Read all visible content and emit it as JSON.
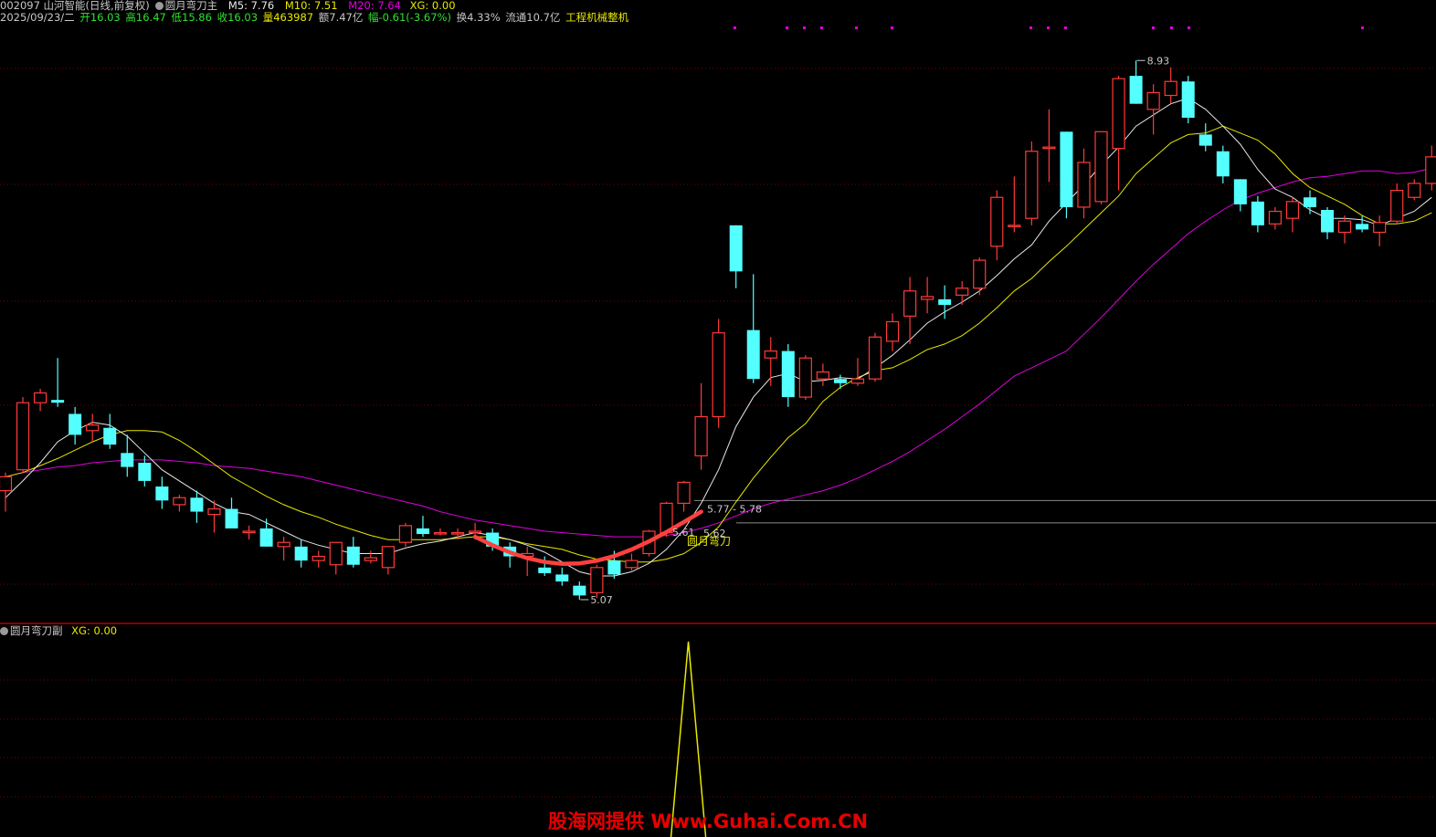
{
  "header": {
    "code_name": "002097 山河智能(日线,前复权)",
    "main_indicator": "圆月弯刀主",
    "m5": "M5: 7.76",
    "m10": "M10: 7.51",
    "m20": "M20: 7.64",
    "xg": "XG: 0.00",
    "date": "2025/09/23/二",
    "open": "开16.03",
    "high": "高16.47",
    "low": "低15.86",
    "close": "收16.03",
    "volume": "量463987",
    "amount": "额7.47亿",
    "change": "幅-0.61(-3.67%)",
    "turnover": "换4.33%",
    "float": "流通10.7亿",
    "industry": "工程机械整机"
  },
  "sub_header": {
    "name": "圆月弯刀副",
    "xg": "XG: 0.00"
  },
  "annotations": {
    "high_label": "8.93",
    "low_label": "5.07",
    "range_label": "5.77 - 5.78",
    "p1": "5.61",
    "p2": "5.62",
    "signal": "圆月弯刀"
  },
  "watermark": "股海网提供 Www.Guhai.Com.CN",
  "colors": {
    "up": "#ff3a3a",
    "down": "#54ffff",
    "m5": "#e8e8e8",
    "m10": "#e8e800",
    "m20": "#e000e0",
    "grid": "#7a0000",
    "separator": "#b00000",
    "arc": "#ff4040"
  },
  "chart_data": [
    {
      "type": "candlestick",
      "title": "圆月弯刀主",
      "ohlc": [
        [
          5.85,
          5.98,
          5.7,
          5.95
        ],
        [
          6.0,
          6.52,
          5.98,
          6.48
        ],
        [
          6.48,
          6.58,
          6.42,
          6.55
        ],
        [
          6.5,
          6.8,
          6.45,
          6.48
        ],
        [
          6.4,
          6.45,
          6.18,
          6.25
        ],
        [
          6.28,
          6.4,
          6.2,
          6.32
        ],
        [
          6.3,
          6.4,
          6.15,
          6.18
        ],
        [
          6.12,
          6.25,
          5.95,
          6.02
        ],
        [
          6.05,
          6.1,
          5.88,
          5.92
        ],
        [
          5.88,
          5.95,
          5.72,
          5.78
        ],
        [
          5.75,
          5.82,
          5.7,
          5.8
        ],
        [
          5.8,
          5.85,
          5.62,
          5.7
        ],
        [
          5.68,
          5.78,
          5.55,
          5.72
        ],
        [
          5.72,
          5.8,
          5.58,
          5.58
        ],
        [
          5.55,
          5.6,
          5.5,
          5.56
        ],
        [
          5.58,
          5.65,
          5.45,
          5.45
        ],
        [
          5.45,
          5.52,
          5.35,
          5.48
        ],
        [
          5.45,
          5.5,
          5.3,
          5.35
        ],
        [
          5.35,
          5.42,
          5.3,
          5.38
        ],
        [
          5.32,
          5.45,
          5.25,
          5.48
        ],
        [
          5.45,
          5.52,
          5.3,
          5.32
        ],
        [
          5.35,
          5.42,
          5.33,
          5.37
        ],
        [
          5.3,
          5.45,
          5.25,
          5.45
        ],
        [
          5.48,
          5.62,
          5.45,
          5.6
        ],
        [
          5.58,
          5.67,
          5.52,
          5.54
        ],
        [
          5.55,
          5.58,
          5.53,
          5.55
        ],
        [
          5.54,
          5.58,
          5.5,
          5.55
        ],
        [
          5.55,
          5.62,
          5.5,
          5.56
        ],
        [
          5.55,
          5.58,
          5.42,
          5.45
        ],
        [
          5.45,
          5.48,
          5.3,
          5.38
        ],
        [
          5.38,
          5.45,
          5.24,
          5.4
        ],
        [
          5.3,
          5.38,
          5.24,
          5.26
        ],
        [
          5.25,
          5.3,
          5.17,
          5.2
        ],
        [
          5.17,
          5.2,
          5.07,
          5.1
        ],
        [
          5.12,
          5.32,
          5.08,
          5.3
        ],
        [
          5.35,
          5.42,
          5.22,
          5.25
        ],
        [
          5.3,
          5.4,
          5.28,
          5.35
        ],
        [
          5.4,
          5.57,
          5.38,
          5.56
        ],
        [
          5.55,
          5.77,
          5.52,
          5.76
        ],
        [
          5.76,
          5.92,
          5.7,
          5.91
        ],
        [
          6.1,
          6.62,
          6.0,
          6.38
        ],
        [
          6.38,
          7.08,
          6.3,
          6.98
        ],
        [
          7.75,
          7.75,
          7.3,
          7.42
        ],
        [
          7.0,
          7.4,
          6.62,
          6.65
        ],
        [
          6.8,
          6.95,
          6.6,
          6.85
        ],
        [
          6.85,
          6.9,
          6.45,
          6.52
        ],
        [
          6.52,
          6.82,
          6.5,
          6.8
        ],
        [
          6.65,
          6.76,
          6.6,
          6.7
        ],
        [
          6.65,
          6.68,
          6.58,
          6.62
        ],
        [
          6.62,
          6.8,
          6.6,
          6.65
        ],
        [
          6.65,
          6.98,
          6.63,
          6.95
        ],
        [
          6.92,
          7.12,
          6.85,
          7.06
        ],
        [
          7.1,
          7.38,
          6.9,
          7.28
        ],
        [
          7.22,
          7.38,
          7.12,
          7.24
        ],
        [
          7.22,
          7.32,
          7.08,
          7.18
        ],
        [
          7.25,
          7.35,
          7.18,
          7.3
        ],
        [
          7.3,
          7.52,
          7.25,
          7.5
        ],
        [
          7.6,
          8.0,
          7.5,
          7.95
        ],
        [
          7.75,
          8.1,
          7.7,
          7.75
        ],
        [
          7.8,
          8.35,
          7.75,
          8.28
        ],
        [
          8.31,
          8.58,
          8.06,
          8.31
        ],
        [
          8.42,
          8.42,
          7.8,
          7.88
        ],
        [
          7.88,
          8.3,
          7.8,
          8.2
        ],
        [
          7.92,
          8.42,
          7.9,
          8.42
        ],
        [
          8.3,
          8.82,
          8.0,
          8.8
        ],
        [
          8.82,
          8.93,
          8.62,
          8.62
        ],
        [
          8.58,
          8.76,
          8.4,
          8.7
        ],
        [
          8.68,
          8.88,
          8.62,
          8.78
        ],
        [
          8.78,
          8.82,
          8.48,
          8.52
        ],
        [
          8.4,
          8.48,
          8.28,
          8.32
        ],
        [
          8.28,
          8.32,
          8.05,
          8.1
        ],
        [
          8.08,
          8.08,
          7.85,
          7.9
        ],
        [
          7.92,
          7.96,
          7.7,
          7.75
        ],
        [
          7.76,
          7.88,
          7.72,
          7.85
        ],
        [
          7.8,
          7.95,
          7.7,
          7.92
        ],
        [
          7.95,
          8.0,
          7.83,
          7.88
        ],
        [
          7.86,
          7.88,
          7.65,
          7.7
        ],
        [
          7.7,
          7.82,
          7.62,
          7.78
        ],
        [
          7.76,
          7.82,
          7.7,
          7.72
        ],
        [
          7.7,
          7.82,
          7.6,
          7.77
        ],
        [
          7.78,
          8.05,
          7.76,
          8.0
        ],
        [
          7.95,
          8.08,
          7.93,
          8.05
        ],
        [
          8.05,
          8.32,
          8.0,
          8.24
        ]
      ],
      "ma5": [
        5.8,
        5.92,
        6.05,
        6.2,
        6.28,
        6.34,
        6.32,
        6.24,
        6.12,
        6.0,
        5.92,
        5.84,
        5.76,
        5.7,
        5.68,
        5.62,
        5.56,
        5.5,
        5.46,
        5.43,
        5.4,
        5.4,
        5.4,
        5.44,
        5.47,
        5.49,
        5.52,
        5.55,
        5.53,
        5.5,
        5.46,
        5.41,
        5.34,
        5.27,
        5.24,
        5.24,
        5.27,
        5.33,
        5.43,
        5.57,
        5.76,
        6.0,
        6.31,
        6.52,
        6.66,
        6.69,
        6.63,
        6.64,
        6.66,
        6.65,
        6.73,
        6.82,
        6.93,
        7.05,
        7.13,
        7.2,
        7.28,
        7.39,
        7.51,
        7.61,
        7.78,
        7.91,
        8.04,
        8.18,
        8.31,
        8.46,
        8.54,
        8.62,
        8.66,
        8.58,
        8.46,
        8.33,
        8.15,
        8.01,
        7.95,
        7.86,
        7.8,
        7.8,
        7.79,
        7.75,
        7.8,
        7.85,
        7.95
      ],
      "ma10": [
        5.95,
        5.98,
        6.03,
        6.08,
        6.14,
        6.2,
        6.25,
        6.28,
        6.28,
        6.27,
        6.21,
        6.13,
        6.04,
        5.95,
        5.88,
        5.81,
        5.75,
        5.7,
        5.66,
        5.61,
        5.57,
        5.53,
        5.5,
        5.5,
        5.5,
        5.5,
        5.51,
        5.52,
        5.52,
        5.5,
        5.47,
        5.45,
        5.43,
        5.39,
        5.36,
        5.35,
        5.34,
        5.34,
        5.36,
        5.4,
        5.48,
        5.59,
        5.77,
        5.94,
        6.09,
        6.23,
        6.33,
        6.49,
        6.59,
        6.66,
        6.71,
        6.73,
        6.79,
        6.86,
        6.9,
        6.96,
        7.05,
        7.16,
        7.28,
        7.37,
        7.49,
        7.6,
        7.72,
        7.84,
        7.96,
        8.12,
        8.23,
        8.34,
        8.4,
        8.41,
        8.46,
        8.41,
        8.36,
        8.26,
        8.12,
        8.02,
        7.96,
        7.9,
        7.82,
        7.76,
        7.76,
        7.78,
        7.84
      ],
      "ma20": [
        5.95,
        5.98,
        6.0,
        6.02,
        6.03,
        6.05,
        6.06,
        6.07,
        6.07,
        6.07,
        6.06,
        6.05,
        6.03,
        6.02,
        6.01,
        5.99,
        5.97,
        5.95,
        5.92,
        5.89,
        5.86,
        5.83,
        5.8,
        5.77,
        5.74,
        5.7,
        5.67,
        5.64,
        5.62,
        5.6,
        5.58,
        5.56,
        5.55,
        5.54,
        5.53,
        5.52,
        5.52,
        5.52,
        5.53,
        5.55,
        5.58,
        5.62,
        5.67,
        5.72,
        5.76,
        5.79,
        5.82,
        5.85,
        5.89,
        5.94,
        6.0,
        6.06,
        6.13,
        6.21,
        6.29,
        6.38,
        6.47,
        6.57,
        6.67,
        6.73,
        6.79,
        6.85,
        6.97,
        7.09,
        7.22,
        7.35,
        7.47,
        7.58,
        7.69,
        7.78,
        7.86,
        7.93,
        7.98,
        8.02,
        8.06,
        8.09,
        8.1,
        8.12,
        8.14,
        8.14,
        8.12,
        8.13,
        8.16
      ],
      "ylim": [
        4.9,
        9.18
      ],
      "annotations": [
        "8.93",
        "5.07",
        "5.77 - 5.78",
        "5.61",
        "5.62",
        "圆月弯刀"
      ]
    },
    {
      "type": "line",
      "title": "圆月弯刀副",
      "series": [
        {
          "name": "XG",
          "spike_index": 39,
          "values": [
            0,
            1,
            0
          ]
        }
      ],
      "ylim": [
        0,
        1
      ]
    }
  ]
}
